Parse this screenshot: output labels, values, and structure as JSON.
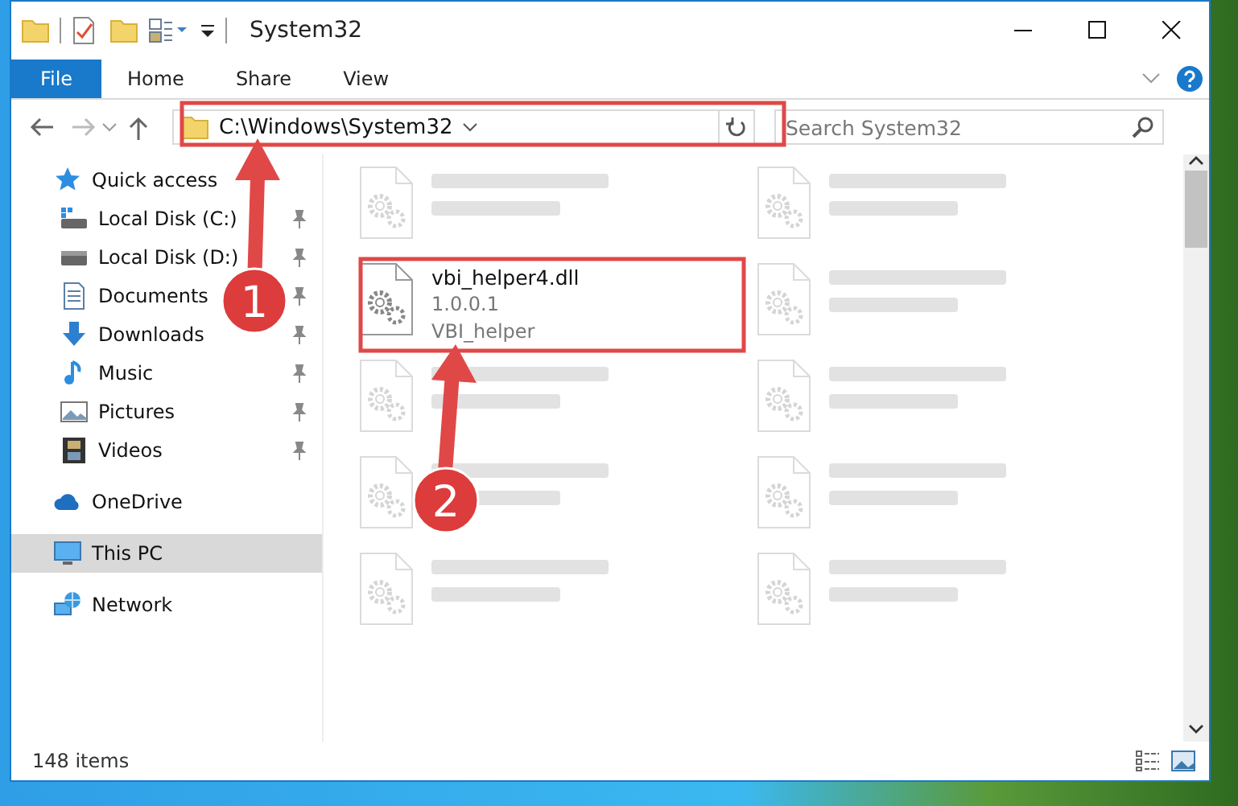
{
  "window": {
    "title": "System32"
  },
  "ribbon": {
    "tabs": [
      {
        "label": "File",
        "selected": true
      },
      {
        "label": "Home",
        "selected": false
      },
      {
        "label": "Share",
        "selected": false
      },
      {
        "label": "View",
        "selected": false
      }
    ]
  },
  "address": {
    "path": "C:\\Windows\\System32"
  },
  "search": {
    "placeholder": "Search System32"
  },
  "nav": [
    {
      "label": "Quick access",
      "kind": "star",
      "selected": false,
      "children": [
        {
          "label": "Local Disk (C:)",
          "kind": "drive-c",
          "pinned": true,
          "selected": false
        },
        {
          "label": "Local Disk (D:)",
          "kind": "drive",
          "pinned": true,
          "selected": false
        },
        {
          "label": "Documents",
          "kind": "documents",
          "pinned": true,
          "selected": false
        },
        {
          "label": "Downloads",
          "kind": "downloads",
          "pinned": true,
          "selected": false
        },
        {
          "label": "Music",
          "kind": "music",
          "pinned": true,
          "selected": false
        },
        {
          "label": "Pictures",
          "kind": "pictures",
          "pinned": true,
          "selected": false
        },
        {
          "label": "Videos",
          "kind": "videos",
          "pinned": true,
          "selected": false
        }
      ]
    },
    {
      "label": "OneDrive",
      "kind": "cloud",
      "selected": false
    },
    {
      "label": "This PC",
      "kind": "pc",
      "selected": true
    },
    {
      "label": "Network",
      "kind": "network",
      "selected": false
    }
  ],
  "files": [
    {
      "blurred": true
    },
    {
      "blurred": true
    },
    {
      "name": "vbi_helper4.dll",
      "details": [
        "1.0.0.1",
        "VBI_helper"
      ],
      "blurred": false
    },
    {
      "blurred": true
    },
    {
      "blurred": true
    },
    {
      "blurred": true
    },
    {
      "blurred": true
    },
    {
      "blurred": true
    },
    {
      "blurred": true
    },
    {
      "blurred": true
    }
  ],
  "status_bar": {
    "count": "148 items"
  },
  "annotations": [
    {
      "label": "1"
    },
    {
      "label": "2"
    }
  ]
}
